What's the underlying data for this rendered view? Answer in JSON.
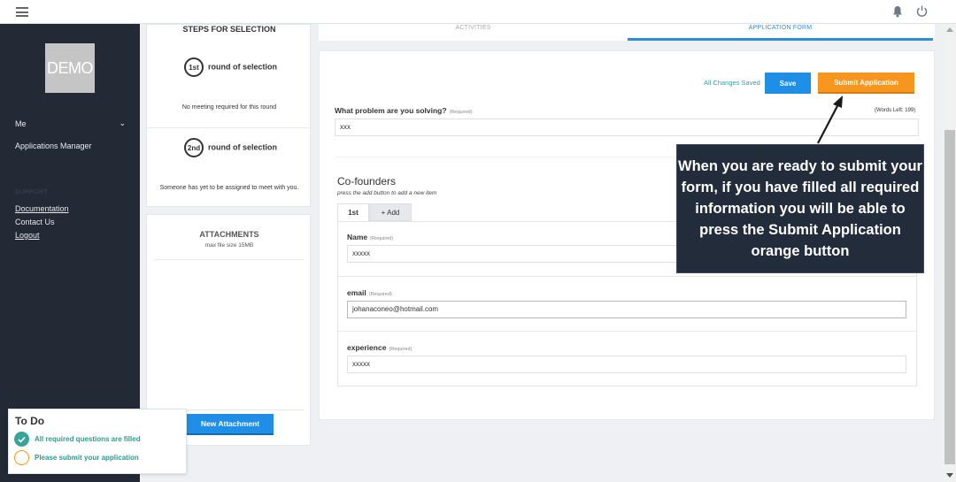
{
  "topbar": {
    "menu_icon": "hamburger-menu-icon",
    "notification_icon": "bell-icon",
    "power_icon": "power-icon"
  },
  "sidebar": {
    "logo_text": "DEMO",
    "me_label": "Me",
    "applications_manager": "Applications Manager",
    "support_heading": "SUPPORT",
    "documentation": "Documentation",
    "contact_us": "Contact Us",
    "logout": "Logout"
  },
  "steps": {
    "title": "STEPS FOR SELECTION",
    "rounds": [
      {
        "badge": "1st",
        "label": "round of selection",
        "note": "No meeting required for this round"
      },
      {
        "badge": "2nd",
        "label": "round of selection",
        "note": "Someone has yet to be assigned to meet with you."
      }
    ]
  },
  "attachments": {
    "title": "ATTACHMENTS",
    "max_size": "max file size 15MB",
    "new_button": "New Attachment"
  },
  "tabs": {
    "activities": "ACTIVITIES",
    "application_form": "APPLICATION FORM"
  },
  "form": {
    "saved_status": "All Changes Saved",
    "save_button": "Save",
    "submit_button": "Submit Application",
    "question_label": "What problem are you solving?",
    "required": "(Required)",
    "words_left": "(Words Left: 199)",
    "question_value": "xxx",
    "cofounders_title": "Co-founders",
    "cofounders_hint": "press the add button to add a new item",
    "cofounder_tabs": [
      "1st",
      "+ Add"
    ],
    "fields": [
      {
        "label": "Name",
        "value": "xxxxx"
      },
      {
        "label": "email",
        "value": "johanaconeo@hotmail.com"
      },
      {
        "label": "experience",
        "value": "xxxxx"
      }
    ]
  },
  "callout": {
    "text": "When you are ready to submit your form, if you have filled all required information you will be able to press the Submit Application orange button"
  },
  "todo": {
    "title": "To Do",
    "items": [
      {
        "text": "All required questions are filled",
        "status": "done"
      },
      {
        "text": "Please submit your application",
        "status": "pending"
      }
    ]
  },
  "colors": {
    "accent_blue": "#1e8ee6",
    "submit_orange": "#f7961e",
    "sidebar_bg": "#232a35",
    "todo_teal": "#2e9a8f"
  }
}
